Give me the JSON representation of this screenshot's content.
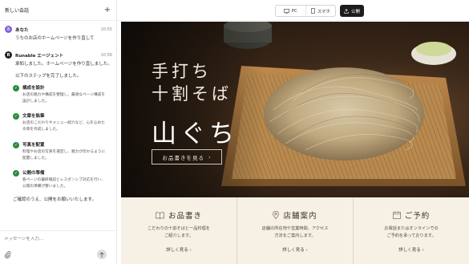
{
  "chat": {
    "header_title": "新しい会話",
    "new_button": "+",
    "user_message": {
      "avatar": "あ",
      "name": "あなた",
      "time": "10:55",
      "text": "うちのお店のホームページを作り直して"
    },
    "bot_message": {
      "avatar": "R",
      "name": "Runable エージェント",
      "time": "10:56",
      "intro_1": "承知しました。ホームページを作り直しました。",
      "intro_2": "以下のステップを完了しました。",
      "steps": [
        {
          "title": "構成を設計",
          "desc_1": "お店の魅力や構成を整理し、最適なページ構成を",
          "desc_2": "設計しました。"
        },
        {
          "title": "文章を執筆",
          "desc_1": "お店のこだわりやメニュー紹介など、心を込めた",
          "desc_2": "文章を作成しました。"
        },
        {
          "title": "写真を配置",
          "desc_1": "料理やお店の写真を選定し、魅力が伝わるように",
          "desc_2": "配置しました。"
        },
        {
          "title": "公開の準備",
          "desc_1": "各ページの最終確認とレスポンシブ対応を行い、",
          "desc_2": "公開の準備が整いました。"
        }
      ],
      "closing": "ご確認のうえ、公開をお願いいたします。"
    },
    "composer": {
      "placeholder": "メッセージを入力...",
      "attach_icon": "paperclip-icon",
      "send_icon": "arrow-up-icon"
    }
  },
  "toolbar": {
    "pc_label": "PC",
    "mobile_label": "スマホ",
    "publish_label": "公開"
  },
  "hero": {
    "title_line1": "手打ち",
    "title_line2": "十割そば",
    "shop_name": "山ぐち",
    "cta_label": "お品書きを見る",
    "cta_arrow": "›"
  },
  "info": [
    {
      "icon": "book-icon",
      "title": "お品書き",
      "desc_1": "こだわりの十割そばと一品料理を",
      "desc_2": "ご紹介します。",
      "link": "詳しく見る ›"
    },
    {
      "icon": "map-pin-icon",
      "title": "店舗案内",
      "desc_1": "店舗の所在地や営業時間、アクセス",
      "desc_2": "方法をご案内します。",
      "link": "詳しく見る ›"
    },
    {
      "icon": "calendar-icon",
      "title": "ご予約",
      "desc_1": "お電話またはオンラインでの",
      "desc_2": "ご予約を承っております。",
      "link": "詳しく見る ›"
    }
  ]
}
